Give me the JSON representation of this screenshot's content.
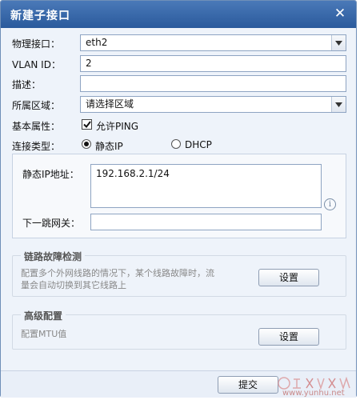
{
  "dialog": {
    "title": "新建子接口",
    "close_glyph": "✕"
  },
  "form": {
    "physical_interface": {
      "label": "物理接口：",
      "value": "eth2"
    },
    "vlan_id": {
      "label": "VLAN ID：",
      "value": "2"
    },
    "description": {
      "label": "描述：",
      "value": ""
    },
    "zone": {
      "label": "所属区域：",
      "value": "请选择区域"
    },
    "basic_attr": {
      "label": "基本属性：",
      "allow_ping_label": "允许PING",
      "allow_ping_checked": true
    },
    "conn_type": {
      "label": "连接类型：",
      "options": [
        {
          "label": "静态IP",
          "selected": true
        },
        {
          "label": "DHCP",
          "selected": false
        }
      ]
    },
    "static_ip": {
      "label": "静态IP地址：",
      "value": "192.168.2.1/24"
    },
    "next_hop": {
      "label": "下一跳网关：",
      "value": ""
    }
  },
  "link_detect": {
    "title": "链路故障检测",
    "desc_line1": "配置多个外网线路的情况下，某个线路故障时，流",
    "desc_line2": "量会自动切换到其它线路上",
    "button": "设置"
  },
  "advanced": {
    "title": "高级配置",
    "desc": "配置MTU值",
    "button": "设置"
  },
  "footer": {
    "submit": "提交"
  },
  "watermark": {
    "text": "www.yunhu.net"
  }
}
